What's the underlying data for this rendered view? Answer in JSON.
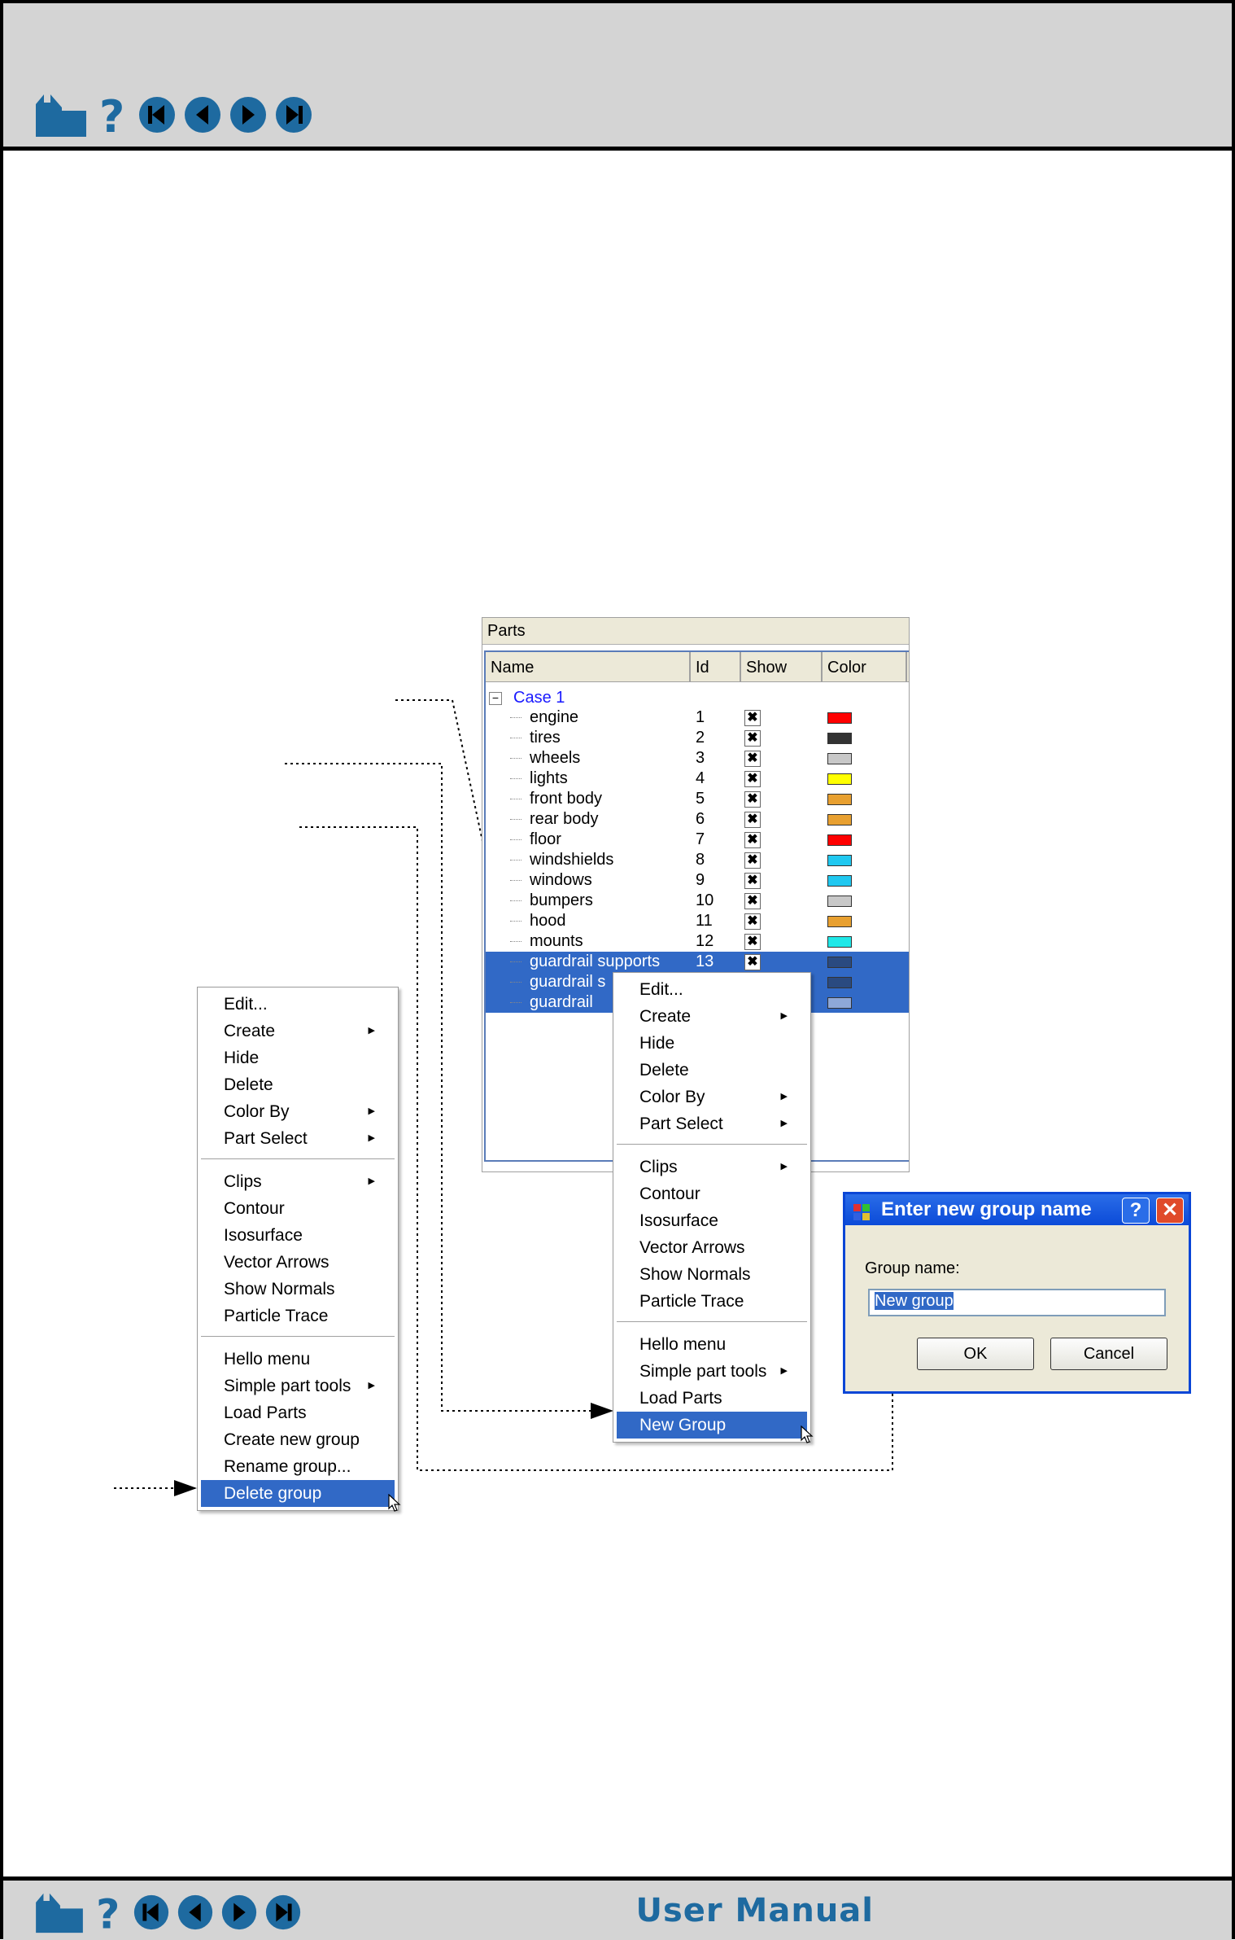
{
  "footer": {
    "title": "User Manual"
  },
  "parts_panel": {
    "title": "Parts",
    "columns": [
      "Name",
      "Id",
      "Show",
      "Color"
    ],
    "case_label": "Case 1",
    "rows": [
      {
        "name": "engine",
        "id": "1",
        "color": "#ff0000",
        "selected": false
      },
      {
        "name": "tires",
        "id": "2",
        "color": "#333333",
        "selected": false
      },
      {
        "name": "wheels",
        "id": "3",
        "color": "#c8c8c8",
        "selected": false
      },
      {
        "name": "lights",
        "id": "4",
        "color": "#ffff00",
        "selected": false
      },
      {
        "name": "front body",
        "id": "5",
        "color": "#e8a030",
        "selected": false
      },
      {
        "name": "rear body",
        "id": "6",
        "color": "#e8a030",
        "selected": false
      },
      {
        "name": "floor",
        "id": "7",
        "color": "#ff0000",
        "selected": false
      },
      {
        "name": "windshields",
        "id": "8",
        "color": "#20c8f0",
        "selected": false
      },
      {
        "name": "windows",
        "id": "9",
        "color": "#20c8f0",
        "selected": false
      },
      {
        "name": "bumpers",
        "id": "10",
        "color": "#c8c8c8",
        "selected": false
      },
      {
        "name": "hood",
        "id": "11",
        "color": "#e8a030",
        "selected": false
      },
      {
        "name": "mounts",
        "id": "12",
        "color": "#20e8e8",
        "selected": false
      },
      {
        "name": "guardrail supports",
        "id": "13",
        "color": "#2a4a80",
        "selected": true
      },
      {
        "name": "guardrail s",
        "id": "",
        "color": "#2a4a80",
        "selected": true
      },
      {
        "name": "guardrail",
        "id": "",
        "color": "#8ea8d8",
        "selected": true
      }
    ],
    "show_mark": "✖"
  },
  "menu_left": [
    {
      "label": "Edit...",
      "sub": false
    },
    {
      "label": "Create",
      "sub": true
    },
    {
      "label": "Hide",
      "sub": false
    },
    {
      "label": "Delete",
      "sub": false
    },
    {
      "label": "Color By",
      "sub": true
    },
    {
      "label": "Part Select",
      "sub": true
    },
    {
      "sep": true
    },
    {
      "label": "Clips",
      "sub": true
    },
    {
      "label": "Contour",
      "sub": false
    },
    {
      "label": "Isosurface",
      "sub": false
    },
    {
      "label": "Vector Arrows",
      "sub": false
    },
    {
      "label": "Show Normals",
      "sub": false
    },
    {
      "label": "Particle Trace",
      "sub": false
    },
    {
      "sep": true
    },
    {
      "label": "Hello menu",
      "sub": false
    },
    {
      "label": "Simple part tools",
      "sub": true
    },
    {
      "label": "Load Parts",
      "sub": false
    },
    {
      "label": "Create new group",
      "sub": false
    },
    {
      "label": "Rename group...",
      "sub": false
    },
    {
      "label": "Delete group",
      "sub": false,
      "highlighted": true
    }
  ],
  "menu_right": [
    {
      "label": "Edit...",
      "sub": false
    },
    {
      "label": "Create",
      "sub": true
    },
    {
      "label": "Hide",
      "sub": false
    },
    {
      "label": "Delete",
      "sub": false
    },
    {
      "label": "Color By",
      "sub": true
    },
    {
      "label": "Part Select",
      "sub": true
    },
    {
      "sep": true
    },
    {
      "label": "Clips",
      "sub": true
    },
    {
      "label": "Contour",
      "sub": false
    },
    {
      "label": "Isosurface",
      "sub": false
    },
    {
      "label": "Vector Arrows",
      "sub": false
    },
    {
      "label": "Show Normals",
      "sub": false
    },
    {
      "label": "Particle Trace",
      "sub": false
    },
    {
      "sep": true
    },
    {
      "label": "Hello menu",
      "sub": false
    },
    {
      "label": "Simple part tools",
      "sub": true
    },
    {
      "label": "Load Parts",
      "sub": false
    },
    {
      "label": "New Group",
      "sub": false,
      "highlighted": true
    }
  ],
  "dialog": {
    "title": "Enter new group name",
    "help_label": "?",
    "close_label": "✕",
    "field_label": "Group name:",
    "field_value": "New group",
    "ok_label": "OK",
    "cancel_label": "Cancel"
  },
  "icons": {
    "home": "home-icon",
    "help": "help-icon",
    "first": "first-page-icon",
    "prev": "previous-page-icon",
    "next": "next-page-icon",
    "last": "last-page-icon"
  },
  "colors": {
    "nav_accent": "#1e6aa0",
    "selection": "#3169c6"
  }
}
